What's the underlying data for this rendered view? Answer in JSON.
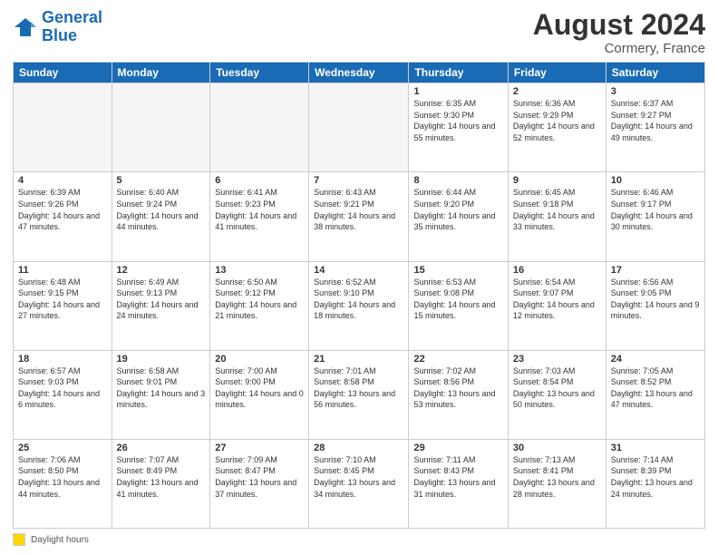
{
  "header": {
    "logo_line1": "General",
    "logo_line2": "Blue",
    "main_title": "August 2024",
    "subtitle": "Cormery, France"
  },
  "legend": {
    "box_label": "Daylight hours"
  },
  "calendar": {
    "days_of_week": [
      "Sunday",
      "Monday",
      "Tuesday",
      "Wednesday",
      "Thursday",
      "Friday",
      "Saturday"
    ],
    "weeks": [
      [
        {
          "day": "",
          "info": ""
        },
        {
          "day": "",
          "info": ""
        },
        {
          "day": "",
          "info": ""
        },
        {
          "day": "",
          "info": ""
        },
        {
          "day": "1",
          "info": "Sunrise: 6:35 AM\nSunset: 9:30 PM\nDaylight: 14 hours\nand 55 minutes."
        },
        {
          "day": "2",
          "info": "Sunrise: 6:36 AM\nSunset: 9:29 PM\nDaylight: 14 hours\nand 52 minutes."
        },
        {
          "day": "3",
          "info": "Sunrise: 6:37 AM\nSunset: 9:27 PM\nDaylight: 14 hours\nand 49 minutes."
        }
      ],
      [
        {
          "day": "4",
          "info": "Sunrise: 6:39 AM\nSunset: 9:26 PM\nDaylight: 14 hours\nand 47 minutes."
        },
        {
          "day": "5",
          "info": "Sunrise: 6:40 AM\nSunset: 9:24 PM\nDaylight: 14 hours\nand 44 minutes."
        },
        {
          "day": "6",
          "info": "Sunrise: 6:41 AM\nSunset: 9:23 PM\nDaylight: 14 hours\nand 41 minutes."
        },
        {
          "day": "7",
          "info": "Sunrise: 6:43 AM\nSunset: 9:21 PM\nDaylight: 14 hours\nand 38 minutes."
        },
        {
          "day": "8",
          "info": "Sunrise: 6:44 AM\nSunset: 9:20 PM\nDaylight: 14 hours\nand 35 minutes."
        },
        {
          "day": "9",
          "info": "Sunrise: 6:45 AM\nSunset: 9:18 PM\nDaylight: 14 hours\nand 33 minutes."
        },
        {
          "day": "10",
          "info": "Sunrise: 6:46 AM\nSunset: 9:17 PM\nDaylight: 14 hours\nand 30 minutes."
        }
      ],
      [
        {
          "day": "11",
          "info": "Sunrise: 6:48 AM\nSunset: 9:15 PM\nDaylight: 14 hours\nand 27 minutes."
        },
        {
          "day": "12",
          "info": "Sunrise: 6:49 AM\nSunset: 9:13 PM\nDaylight: 14 hours\nand 24 minutes."
        },
        {
          "day": "13",
          "info": "Sunrise: 6:50 AM\nSunset: 9:12 PM\nDaylight: 14 hours\nand 21 minutes."
        },
        {
          "day": "14",
          "info": "Sunrise: 6:52 AM\nSunset: 9:10 PM\nDaylight: 14 hours\nand 18 minutes."
        },
        {
          "day": "15",
          "info": "Sunrise: 6:53 AM\nSunset: 9:08 PM\nDaylight: 14 hours\nand 15 minutes."
        },
        {
          "day": "16",
          "info": "Sunrise: 6:54 AM\nSunset: 9:07 PM\nDaylight: 14 hours\nand 12 minutes."
        },
        {
          "day": "17",
          "info": "Sunrise: 6:56 AM\nSunset: 9:05 PM\nDaylight: 14 hours\nand 9 minutes."
        }
      ],
      [
        {
          "day": "18",
          "info": "Sunrise: 6:57 AM\nSunset: 9:03 PM\nDaylight: 14 hours\nand 6 minutes."
        },
        {
          "day": "19",
          "info": "Sunrise: 6:58 AM\nSunset: 9:01 PM\nDaylight: 14 hours\nand 3 minutes."
        },
        {
          "day": "20",
          "info": "Sunrise: 7:00 AM\nSunset: 9:00 PM\nDaylight: 14 hours\nand 0 minutes."
        },
        {
          "day": "21",
          "info": "Sunrise: 7:01 AM\nSunset: 8:58 PM\nDaylight: 13 hours\nand 56 minutes."
        },
        {
          "day": "22",
          "info": "Sunrise: 7:02 AM\nSunset: 8:56 PM\nDaylight: 13 hours\nand 53 minutes."
        },
        {
          "day": "23",
          "info": "Sunrise: 7:03 AM\nSunset: 8:54 PM\nDaylight: 13 hours\nand 50 minutes."
        },
        {
          "day": "24",
          "info": "Sunrise: 7:05 AM\nSunset: 8:52 PM\nDaylight: 13 hours\nand 47 minutes."
        }
      ],
      [
        {
          "day": "25",
          "info": "Sunrise: 7:06 AM\nSunset: 8:50 PM\nDaylight: 13 hours\nand 44 minutes."
        },
        {
          "day": "26",
          "info": "Sunrise: 7:07 AM\nSunset: 8:49 PM\nDaylight: 13 hours\nand 41 minutes."
        },
        {
          "day": "27",
          "info": "Sunrise: 7:09 AM\nSunset: 8:47 PM\nDaylight: 13 hours\nand 37 minutes."
        },
        {
          "day": "28",
          "info": "Sunrise: 7:10 AM\nSunset: 8:45 PM\nDaylight: 13 hours\nand 34 minutes."
        },
        {
          "day": "29",
          "info": "Sunrise: 7:11 AM\nSunset: 8:43 PM\nDaylight: 13 hours\nand 31 minutes."
        },
        {
          "day": "30",
          "info": "Sunrise: 7:13 AM\nSunset: 8:41 PM\nDaylight: 13 hours\nand 28 minutes."
        },
        {
          "day": "31",
          "info": "Sunrise: 7:14 AM\nSunset: 8:39 PM\nDaylight: 13 hours\nand 24 minutes."
        }
      ]
    ]
  }
}
